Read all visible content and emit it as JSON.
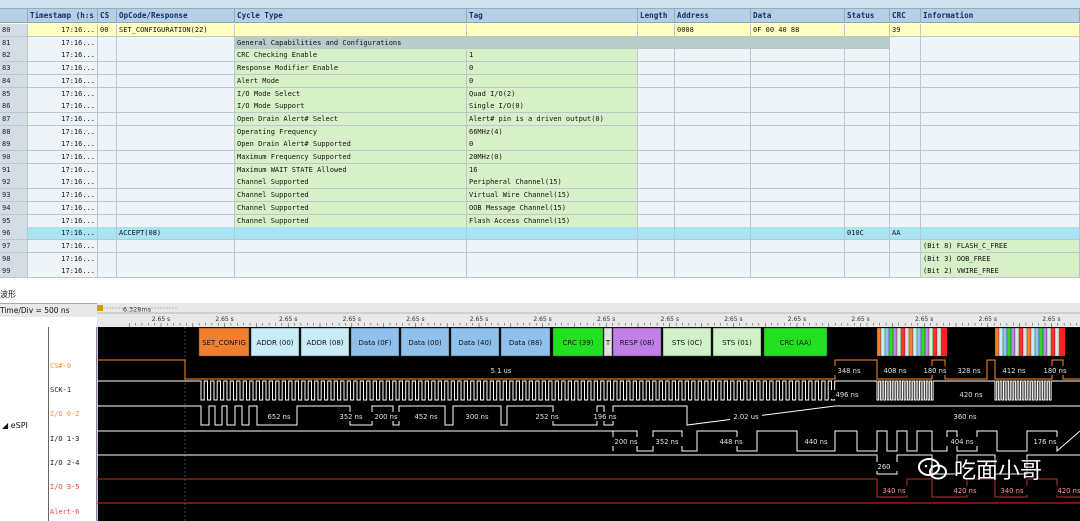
{
  "table": {
    "columns": [
      "Timestamp (h:s",
      "CS",
      "OpCode/Response",
      "Cycle Type",
      "Tag",
      "Length",
      "Address",
      "Data",
      "Status",
      "CRC",
      "Information"
    ],
    "rows": [
      {
        "n": "80",
        "ts": "17:16...",
        "cs": "00",
        "op": "SET_CONFIGURATION(22)",
        "cyc": "",
        "tag": "",
        "len": "",
        "addr": "0008",
        "data": "0F 00 40 88",
        "status": "",
        "crc": "39",
        "info": "",
        "style": "yellow"
      },
      {
        "n": "81",
        "ts": "17:16...",
        "cs": "",
        "op": "",
        "cyc": "General Capabilities and Configurations",
        "tag": "",
        "len": "",
        "addr": "",
        "data": "",
        "status": "",
        "crc": "",
        "info": "",
        "style": "group"
      },
      {
        "n": "82",
        "ts": "17:16...",
        "cs": "",
        "op": "",
        "cyc": "CRC Checking Enable",
        "tag": "1",
        "len": "",
        "addr": "",
        "data": "",
        "status": "",
        "crc": "",
        "info": "",
        "style": "field"
      },
      {
        "n": "83",
        "ts": "17:16...",
        "cs": "",
        "op": "",
        "cyc": "Response Modifier Enable",
        "tag": "0",
        "len": "",
        "addr": "",
        "data": "",
        "status": "",
        "crc": "",
        "info": "",
        "style": "field"
      },
      {
        "n": "84",
        "ts": "17:16...",
        "cs": "",
        "op": "",
        "cyc": "Alert Mode",
        "tag": "0",
        "len": "",
        "addr": "",
        "data": "",
        "status": "",
        "crc": "",
        "info": "",
        "style": "field"
      },
      {
        "n": "85",
        "ts": "17:16...",
        "cs": "",
        "op": "",
        "cyc": "I/O Mode Select",
        "tag": "Quad I/O(2)",
        "len": "",
        "addr": "",
        "data": "",
        "status": "",
        "crc": "",
        "info": "",
        "style": "field"
      },
      {
        "n": "86",
        "ts": "17:16...",
        "cs": "",
        "op": "",
        "cyc": "I/O Mode Support",
        "tag": "Single I/O(0)",
        "len": "",
        "addr": "",
        "data": "",
        "status": "",
        "crc": "",
        "info": "",
        "style": "field"
      },
      {
        "n": "87",
        "ts": "17:16...",
        "cs": "",
        "op": "",
        "cyc": "Open Drain Alert# Select",
        "tag": "Alert# pin is a driven output(0)",
        "len": "",
        "addr": "",
        "data": "",
        "status": "",
        "crc": "",
        "info": "",
        "style": "field"
      },
      {
        "n": "88",
        "ts": "17:16...",
        "cs": "",
        "op": "",
        "cyc": "Operating Frequency",
        "tag": "66MHz(4)",
        "len": "",
        "addr": "",
        "data": "",
        "status": "",
        "crc": "",
        "info": "",
        "style": "field"
      },
      {
        "n": "89",
        "ts": "17:16...",
        "cs": "",
        "op": "",
        "cyc": "Open Drain Alert# Supported",
        "tag": "0",
        "len": "",
        "addr": "",
        "data": "",
        "status": "",
        "crc": "",
        "info": "",
        "style": "field"
      },
      {
        "n": "90",
        "ts": "17:16...",
        "cs": "",
        "op": "",
        "cyc": "Maximum Frequency Supported",
        "tag": "20MHz(0)",
        "len": "",
        "addr": "",
        "data": "",
        "status": "",
        "crc": "",
        "info": "",
        "style": "field"
      },
      {
        "n": "91",
        "ts": "17:16...",
        "cs": "",
        "op": "",
        "cyc": "Maximum WAIT STATE Allowed",
        "tag": "16",
        "len": "",
        "addr": "",
        "data": "",
        "status": "",
        "crc": "",
        "info": "",
        "style": "field"
      },
      {
        "n": "92",
        "ts": "17:16...",
        "cs": "",
        "op": "",
        "cyc": "Channel Supported",
        "tag": "Peripheral Channel(15)",
        "len": "",
        "addr": "",
        "data": "",
        "status": "",
        "crc": "",
        "info": "",
        "style": "field"
      },
      {
        "n": "93",
        "ts": "17:16...",
        "cs": "",
        "op": "",
        "cyc": "Channel Supported",
        "tag": "Virtual Wire Channel(15)",
        "len": "",
        "addr": "",
        "data": "",
        "status": "",
        "crc": "",
        "info": "",
        "style": "field"
      },
      {
        "n": "94",
        "ts": "17:16...",
        "cs": "",
        "op": "",
        "cyc": "Channel Supported",
        "tag": "OOB Message Channel(15)",
        "len": "",
        "addr": "",
        "data": "",
        "status": "",
        "crc": "",
        "info": "",
        "style": "field"
      },
      {
        "n": "95",
        "ts": "17:16...",
        "cs": "",
        "op": "",
        "cyc": "Channel Supported",
        "tag": "Flash Access Channel(15)",
        "len": "",
        "addr": "",
        "data": "",
        "status": "",
        "crc": "",
        "info": "",
        "style": "field"
      },
      {
        "n": "96",
        "ts": "17:16...",
        "cs": "",
        "op": "ACCEPT(08)",
        "cyc": "",
        "tag": "",
        "len": "",
        "addr": "",
        "data": "",
        "status": "010C",
        "crc": "AA",
        "info": "",
        "style": "cyan"
      },
      {
        "n": "97",
        "ts": "17:16...",
        "cs": "",
        "op": "",
        "cyc": "",
        "tag": "",
        "len": "",
        "addr": "",
        "data": "",
        "status": "",
        "crc": "",
        "info": "(Bit 8) FLASH_C_FREE",
        "style": "info"
      },
      {
        "n": "98",
        "ts": "17:16...",
        "cs": "",
        "op": "",
        "cyc": "",
        "tag": "",
        "len": "",
        "addr": "",
        "data": "",
        "status": "",
        "crc": "",
        "info": "(Bit 3) OOB_FREE",
        "style": "info"
      },
      {
        "n": "99",
        "ts": "17:16...",
        "cs": "",
        "op": "",
        "cyc": "",
        "tag": "",
        "len": "",
        "addr": "",
        "data": "",
        "status": "",
        "crc": "",
        "info": "(Bit 2) VWIRE_FREE",
        "style": "info"
      }
    ]
  },
  "colors": {
    "yellow_row": "#ffffc0",
    "group_row": "#b8ccc8",
    "field_row": "#d8f0c8",
    "cyan_row": "#a8e4f4",
    "info_row": "#d8f0c8",
    "plain": "#eef4f8",
    "wave_line": "#ffffff",
    "cs_line": "#ff8000",
    "io3_line": "#c03030",
    "alert_line": "#ff2020"
  },
  "waveform": {
    "panel_title": "波形",
    "time_div": "Time/Div = 500 ns",
    "cursor_label": "6.328ms",
    "tick_labels": [
      "2.65 s",
      "2.65 s",
      "2.65 s",
      "2.65 s",
      "2.65 s",
      "2.65 s",
      "2.65 s",
      "2.65 s",
      "2.65 s",
      "2.65 s",
      "2.65 s",
      "2.65 s",
      "2.65 s",
      "2.65 s",
      "2.65 s",
      "2.65 s"
    ],
    "group_label": "eSPI",
    "signals": [
      {
        "name": "CS#-0",
        "color": "#ff9020"
      },
      {
        "name": "SCK-1",
        "color": "#ffffff"
      },
      {
        "name": "I/O 0-2",
        "color": "#ff9020"
      },
      {
        "name": "I/O 1-3",
        "color": "#ffffff"
      },
      {
        "name": "I/O 2-4",
        "color": "#ffffff"
      },
      {
        "name": "I/O 3-5",
        "color": "#ff4040"
      },
      {
        "name": "Alert-6",
        "color": "#ff4040"
      }
    ],
    "packets": [
      {
        "label": "SET_CONFIG",
        "color": "#f08030"
      },
      {
        "label": "ADDR (00)",
        "color": "#c8ecf8"
      },
      {
        "label": "ADDR (08)",
        "color": "#c8ecf8"
      },
      {
        "label": "Data (0F)",
        "color": "#90c0ec"
      },
      {
        "label": "Data (00)",
        "color": "#90c0ec"
      },
      {
        "label": "Data (40)",
        "color": "#90c0ec"
      },
      {
        "label": "Data (88)",
        "color": "#90c0ec"
      },
      {
        "label": "CRC (39)",
        "color": "#20e020"
      },
      {
        "label": "T",
        "color": "#e0e0e0"
      },
      {
        "label": "RESP (08)",
        "color": "#c080e8"
      },
      {
        "label": "STS (0C)",
        "color": "#d0f0c8"
      },
      {
        "label": "STS (01)",
        "color": "#d0f0c8"
      },
      {
        "label": "CRC (AA)",
        "color": "#20e020"
      }
    ],
    "annotations": {
      "cs": [
        "5.1 us",
        "348 ns",
        "408 ns",
        "180 ns",
        "328 ns",
        "412 ns",
        "180 ns"
      ],
      "sck": [
        "496 ns",
        "420 ns"
      ],
      "io0": [
        "652 ns",
        "352 ns",
        "200 ns",
        "452 ns",
        "300 ns",
        "252 ns",
        "196 ns",
        "2.02 us",
        "360 ns"
      ],
      "io1": [
        "200 ns",
        "352 ns",
        "448 ns",
        "440 ns",
        "404 ns",
        "176 ns"
      ],
      "io2": [
        "260"
      ],
      "io3": [
        "340 ns",
        "420 ns",
        "340 ns",
        "420 ns"
      ]
    },
    "watermark": "吃面小哥"
  }
}
